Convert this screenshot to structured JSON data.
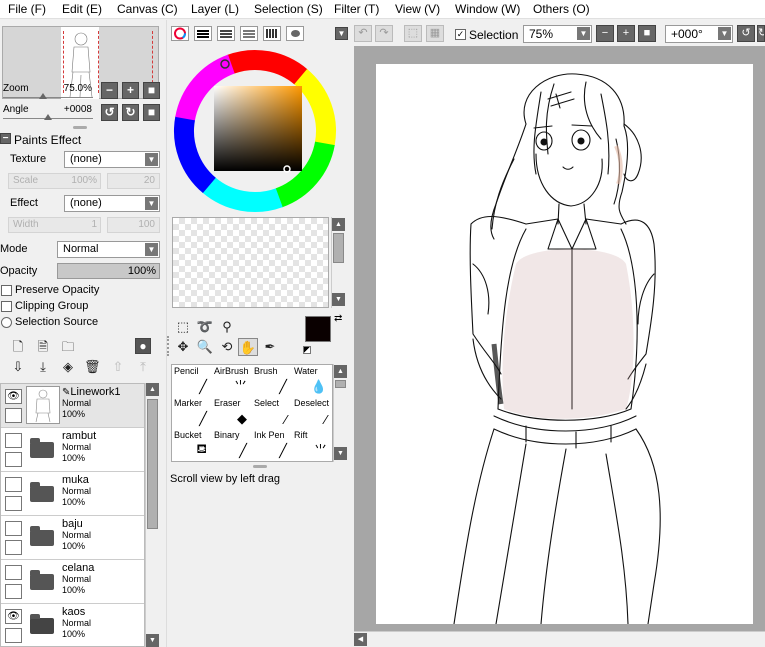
{
  "menu": [
    "File (F)",
    "Edit (E)",
    "Canvas (C)",
    "Layer (L)",
    "Selection (S)",
    "Filter (T)",
    "View (V)",
    "Window (W)",
    "Others (O)"
  ],
  "navigator": {
    "zoom_label": "Zoom",
    "zoom_value": "75.0%",
    "angle_label": "Angle",
    "angle_value": "+0008"
  },
  "paints_effect": {
    "header": "Paints Effect",
    "texture_label": "Texture",
    "texture_value": "(none)",
    "scale_label": "Scale",
    "scale_value": "100%",
    "scale_num": "20",
    "effect_label": "Effect",
    "effect_value": "(none)",
    "width_label": "Width",
    "width_value": "1",
    "width_num": "100"
  },
  "layer_props": {
    "mode_label": "Mode",
    "mode_value": "Normal",
    "opacity_label": "Opacity",
    "opacity_value": "100%",
    "preserve_opacity": "Preserve Opacity",
    "clipping_group": "Clipping Group",
    "selection_source": "Selection Source"
  },
  "layers": [
    {
      "name": "Linework1",
      "mode": "Normal",
      "opacity": "100%",
      "type": "layer",
      "visible": true,
      "selected": true
    },
    {
      "name": "rambut",
      "mode": "Normal",
      "opacity": "100%",
      "type": "folder",
      "visible": false,
      "selected": false
    },
    {
      "name": "muka",
      "mode": "Normal",
      "opacity": "100%",
      "type": "folder",
      "visible": false,
      "selected": false
    },
    {
      "name": "baju",
      "mode": "Normal",
      "opacity": "100%",
      "type": "folder",
      "visible": false,
      "selected": false
    },
    {
      "name": "celana",
      "mode": "Normal",
      "opacity": "100%",
      "type": "folder",
      "visible": false,
      "selected": false
    },
    {
      "name": "kaos",
      "mode": "Normal",
      "opacity": "100%",
      "type": "folder",
      "visible": true,
      "selected": false
    }
  ],
  "colors": {
    "primary": "#0a0000",
    "secondary": "#ffffff",
    "picker_hue": "#ff9900"
  },
  "tools": [
    {
      "label": "Pencil",
      "icon": "pencil-icon"
    },
    {
      "label": "AirBrush",
      "icon": "airbrush-icon"
    },
    {
      "label": "Brush",
      "icon": "brush-icon"
    },
    {
      "label": "Water",
      "icon": "water-icon"
    },
    {
      "label": "Marker",
      "icon": "marker-icon"
    },
    {
      "label": "Eraser",
      "icon": "eraser-icon"
    },
    {
      "label": "Select",
      "icon": "select-brush-icon"
    },
    {
      "label": "Deselect",
      "icon": "deselect-brush-icon"
    },
    {
      "label": "Bucket",
      "icon": "bucket-icon"
    },
    {
      "label": "Binary",
      "icon": "binary-pen-icon"
    },
    {
      "label": "Ink Pen",
      "icon": "ink-pen-icon"
    },
    {
      "label": "Rift",
      "icon": "rift-icon"
    }
  ],
  "hint": "Scroll view by left drag",
  "canvas_toolbar": {
    "selection_label": "Selection",
    "zoom_value": "75%",
    "angle_value": "+000°"
  }
}
